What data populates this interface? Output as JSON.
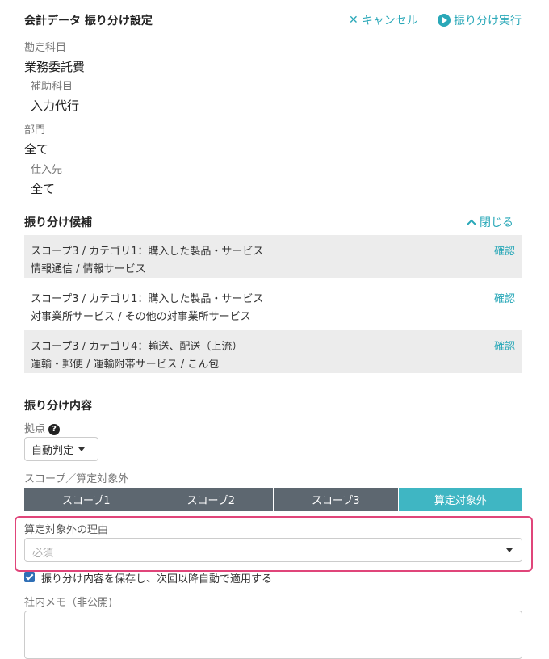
{
  "header": {
    "title": "会計データ 振り分け設定",
    "cancel_label": "キャンセル",
    "execute_label": "振り分け実行"
  },
  "account": {
    "label": "勘定科目",
    "value": "業務委託費",
    "sub_label": "補助科目",
    "sub_value": "入力代行"
  },
  "department": {
    "label": "部門",
    "value": "全て",
    "supplier_label": "仕入先",
    "supplier_value": "全て"
  },
  "candidates": {
    "title": "振り分け候補",
    "close_label": "閉じる",
    "items": [
      {
        "line1": "スコープ3 / カテゴリ1：購入した製品・サービス",
        "line2": "情報通信 / 情報サービス",
        "action": "確認"
      },
      {
        "line1": "スコープ3 / カテゴリ1：購入した製品・サービス",
        "line2": "対事業所サービス / その他の対事業所サービス",
        "action": "確認"
      },
      {
        "line1": "スコープ3 / カテゴリ4：輸送、配送（上流）",
        "line2": "運輸・郵便 / 運輸附帯サービス / こん包",
        "action": "確認"
      }
    ]
  },
  "content": {
    "title": "振り分け内容",
    "base_label": "拠点",
    "base_value": "自動判定",
    "scope_label": "スコープ／算定対象外",
    "scopes": [
      "スコープ1",
      "スコープ2",
      "スコープ3",
      "算定対象外"
    ],
    "active_scope": "算定対象外",
    "reason_label": "算定対象外の理由",
    "reason_placeholder": "必須",
    "save_rule_label": "振り分け内容を保存し、次回以降自動で適用する",
    "save_rule_checked": true,
    "memo_label": "社内メモ（非公開)"
  },
  "colors": {
    "accent": "#2aa8b8",
    "active_segment": "#3fb6c3",
    "segment": "#5d6770",
    "highlight": "#e0457a",
    "checkbox": "#2f6fb6"
  }
}
